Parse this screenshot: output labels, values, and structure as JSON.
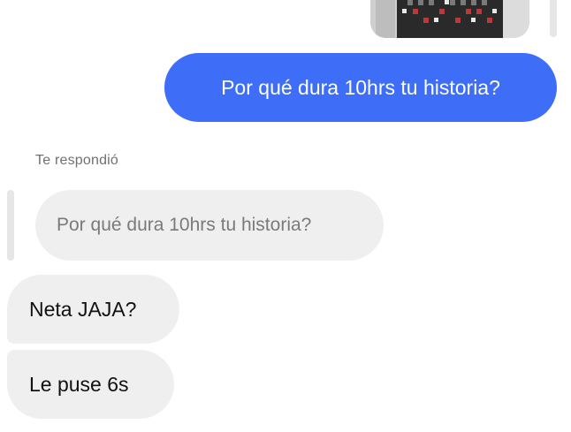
{
  "thread": {
    "outgoing_message": "Por qué dura 10hrs tu historia?",
    "reply_caption": "Te respondió",
    "quoted_message": "Por qué dura 10hrs tu historia?",
    "incoming_messages": [
      {
        "text": "Neta JAJA?"
      },
      {
        "text": "Le puse 6s"
      }
    ]
  },
  "colors": {
    "outgoing_bubble": "#3e6ef7",
    "incoming_bubble": "#efefef",
    "caption_text": "#707070"
  }
}
